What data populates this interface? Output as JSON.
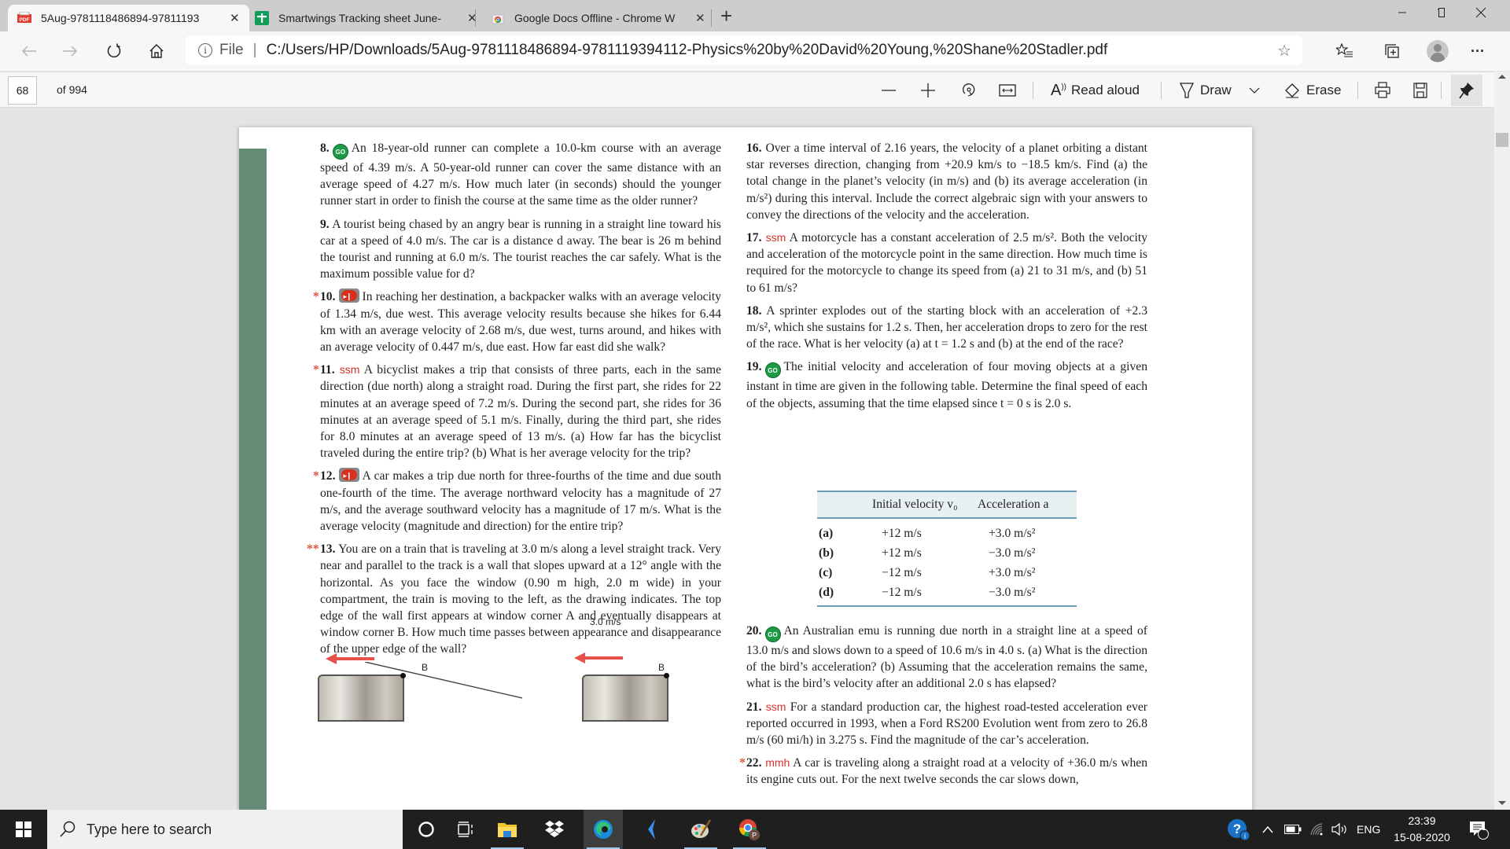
{
  "browser": {
    "tabs": [
      {
        "label": "5Aug-9781118486894-97811193",
        "icon": "pdf-icon",
        "active": true
      },
      {
        "label": "Smartwings Tracking sheet June-",
        "icon": "google-sheets-icon",
        "active": false
      },
      {
        "label": "Google Docs Offline - Chrome W",
        "icon": "chrome-web-store-icon",
        "active": false
      }
    ],
    "new_tab_label": "+",
    "close_glyph": "✕",
    "window_controls": {
      "minimize": "—",
      "restore": "❐",
      "close": "✕"
    },
    "address": {
      "scheme_label": "File",
      "url": "C:/Users/HP/Downloads/5Aug-9781118486894-9781119394112-Physics%20by%20David%20Young,%20Shane%20Stadler.pdf"
    }
  },
  "pdf_toolbar": {
    "current_page": "68",
    "page_count_label": "of 994",
    "zoom_out": "—",
    "zoom_in": "+",
    "read_aloud_label": "Read aloud",
    "draw_label": "Draw",
    "erase_label": "Erase"
  },
  "document": {
    "left_column": [
      {
        "number": "8.",
        "marker": "",
        "badge": "go",
        "tag": "",
        "text": "An 18-year-old runner can complete a 10.0-km course with an average speed of 4.39 m/s. A 50-year-old runner can cover the same distance with an average speed of 4.27 m/s. How much later (in seconds) should the younger runner start in order to finish the course at the same time as the older runner?"
      },
      {
        "number": "9.",
        "marker": "",
        "badge": "",
        "tag": "",
        "text": "A tourist being chased by an angry bear is running in a straight line toward his car at a speed of 4.0 m/s. The car is a distance d away. The bear is 26 m behind the tourist and running at 6.0 m/s. The tourist reaches the car safely. What is the maximum possible value for d?"
      },
      {
        "number": "10.",
        "marker": "*",
        "badge": "video",
        "tag": "",
        "text": "In reaching her destination, a backpacker walks with an average velocity of 1.34 m/s, due west. This average velocity results because she hikes for 6.44 km with an average velocity of 2.68 m/s, due west, turns around, and hikes with an average velocity of 0.447 m/s, due east. How far east did she walk?"
      },
      {
        "number": "11.",
        "marker": "*",
        "badge": "",
        "tag": "ssm",
        "text": "A bicyclist makes a trip that consists of three parts, each in the same direction (due north) along a straight road. During the first part, she rides for 22 minutes at an average speed of 7.2 m/s. During the second part, she rides for 36 minutes at an average speed of 5.1 m/s. Finally, during the third part, she rides for 8.0 minutes at an average speed of 13 m/s. (a) How far has the bicyclist traveled during the entire trip? (b) What is her average velocity for the trip?"
      },
      {
        "number": "12.",
        "marker": "*",
        "badge": "video",
        "tag": "",
        "text": "A car makes a trip due north for three-fourths of the time and due south one-fourth of the time. The average northward velocity has a magnitude of 27 m/s, and the average southward velocity has a magnitude of 17 m/s. What is the average velocity (magnitude and direction) for the entire trip?"
      },
      {
        "number": "13.",
        "marker": "**",
        "badge": "",
        "tag": "",
        "text": "You are on a train that is traveling at 3.0 m/s along a level straight track. Very near and parallel to the track is a wall that slopes upward at a 12° angle with the horizontal. As you face the window (0.90 m high, 2.0 m wide) in your compartment, the train is moving to the left, as the drawing indicates. The top edge of the wall first appears at window corner A and eventually disappears at window corner B. How much time passes between appearance and disappearance of the upper edge of the wall?"
      }
    ],
    "right_column": [
      {
        "number": "16.",
        "marker": "",
        "badge": "",
        "tag": "",
        "text": "Over a time interval of 2.16 years, the velocity of a planet orbiting a distant star reverses direction, changing from +20.9 km/s to −18.5 km/s. Find (a) the total change in the planet’s velocity (in m/s) and (b) its average acceleration (in m/s²) during this interval. Include the correct algebraic sign with your answers to convey the directions of the velocity and the acceleration."
      },
      {
        "number": "17.",
        "marker": "",
        "badge": "",
        "tag": "ssm",
        "text": "A motorcycle has a constant acceleration of 2.5 m/s². Both the velocity and acceleration of the motorcycle point in the same direction. How much time is required for the motorcycle to change its speed from (a) 21 to 31 m/s, and (b) 51 to 61 m/s?"
      },
      {
        "number": "18.",
        "marker": "",
        "badge": "",
        "tag": "",
        "text": "A sprinter explodes out of the starting block with an acceleration of +2.3 m/s², which she sustains for 1.2 s. Then, her acceleration drops to zero for the rest of the race. What is her velocity (a) at t = 1.2 s and (b) at the end of the race?"
      },
      {
        "number": "19.",
        "marker": "",
        "badge": "go",
        "tag": "",
        "text": "The initial velocity and acceleration of four moving objects at a given instant in time are given in the following table. Determine the final speed of each of the objects, assuming that the time elapsed since t = 0 s is 2.0 s."
      },
      {
        "number": "20.",
        "marker": "",
        "badge": "go",
        "tag": "",
        "text": "An Australian emu is running due north in a straight line at a speed of 13.0 m/s and slows down to a speed of 10.6 m/s in 4.0 s. (a) What is the direction of the bird’s acceleration? (b) Assuming that the acceleration remains the same, what is the bird’s velocity after an additional 2.0 s has elapsed?"
      },
      {
        "number": "21.",
        "marker": "",
        "badge": "",
        "tag": "ssm",
        "text": "For a standard production car, the highest road-tested acceleration ever reported occurred in 1993, when a Ford RS200 Evolution went from zero to 26.8 m/s (60 mi/h) in 3.275 s. Find the magnitude of the car’s acceleration."
      },
      {
        "number": "22.",
        "marker": "*",
        "badge": "",
        "tag": "mmh",
        "text": "A car is traveling along a straight road at a velocity of +36.0 m/s when its engine cuts out. For the next twelve seconds the car slows down,"
      }
    ],
    "table": {
      "headers": [
        "",
        "Initial velocity v₀",
        "Acceleration a"
      ],
      "rows": [
        [
          "(a)",
          "+12 m/s",
          "+3.0 m/s²"
        ],
        [
          "(b)",
          "+12 m/s",
          "−3.0 m/s²"
        ],
        [
          "(c)",
          "−12 m/s",
          "+3.0 m/s²"
        ],
        [
          "(d)",
          "−12 m/s",
          "−3.0 m/s²"
        ]
      ]
    },
    "figure": {
      "speed_label": "3.0 m/s",
      "corner_label_b": "B"
    }
  },
  "taskbar": {
    "search_placeholder": "Type here to search",
    "pinned": [
      "cortana-icon",
      "task-view-icon",
      "file-explorer-icon",
      "dropbox-icon",
      "edge-icon",
      "visual-studio-code-icon",
      "paint-icon",
      "chrome-icon"
    ],
    "language": "ENG",
    "time": "23:39",
    "date": "15-08-2020",
    "notification_count": "1"
  }
}
